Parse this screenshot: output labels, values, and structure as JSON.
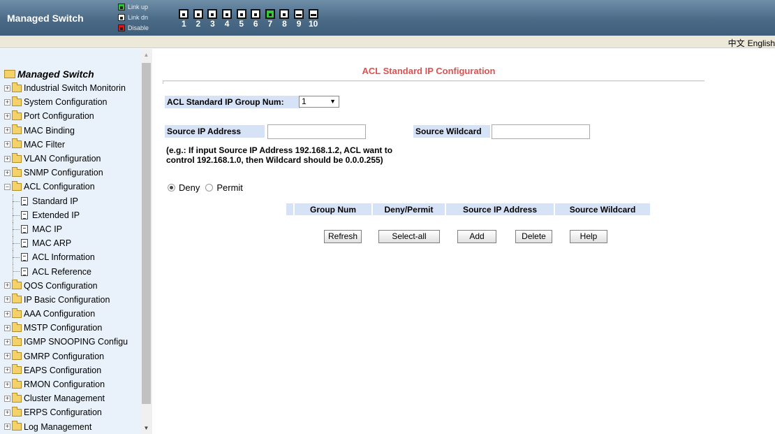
{
  "header": {
    "brand": "Managed Switch",
    "legend": [
      {
        "label": "Link up",
        "state": "up"
      },
      {
        "label": "Link dn",
        "state": "dn"
      },
      {
        "label": "Disable",
        "state": "dis"
      }
    ],
    "ports": [
      {
        "num": "1",
        "state": "dn"
      },
      {
        "num": "2",
        "state": "dn"
      },
      {
        "num": "3",
        "state": "dn"
      },
      {
        "num": "4",
        "state": "dn"
      },
      {
        "num": "5",
        "state": "dn"
      },
      {
        "num": "6",
        "state": "dn"
      },
      {
        "num": "7",
        "state": "up"
      },
      {
        "num": "8",
        "state": "dn"
      },
      {
        "num": "9",
        "state": "sfp"
      },
      {
        "num": "10",
        "state": "sfp"
      }
    ],
    "colors": {
      "link_up": "#36c03a",
      "link_dn": "#ffffff",
      "disable": "#d8181b"
    }
  },
  "language": {
    "chinese": "中文",
    "english": "English"
  },
  "sidebar": {
    "root": "Managed Switch",
    "items": [
      {
        "label": "Industrial Switch Monitorin",
        "type": "folder",
        "expanded": false
      },
      {
        "label": "System Configuration",
        "type": "folder",
        "expanded": false
      },
      {
        "label": "Port Configuration",
        "type": "folder",
        "expanded": false
      },
      {
        "label": "MAC Binding",
        "type": "folder",
        "expanded": false
      },
      {
        "label": "MAC Filter",
        "type": "folder",
        "expanded": false
      },
      {
        "label": "VLAN Configuration",
        "type": "folder",
        "expanded": false
      },
      {
        "label": "SNMP Configuration",
        "type": "folder",
        "expanded": false
      },
      {
        "label": "ACL Configuration",
        "type": "folder",
        "expanded": true
      },
      {
        "label": "Standard IP",
        "type": "page"
      },
      {
        "label": "Extended IP",
        "type": "page"
      },
      {
        "label": "MAC IP",
        "type": "page"
      },
      {
        "label": "MAC ARP",
        "type": "page"
      },
      {
        "label": "ACL Information",
        "type": "page"
      },
      {
        "label": "ACL Reference",
        "type": "page"
      },
      {
        "label": "QOS Configuration",
        "type": "folder",
        "expanded": false
      },
      {
        "label": "IP Basic Configuration",
        "type": "folder",
        "expanded": false
      },
      {
        "label": "AAA Configuration",
        "type": "folder",
        "expanded": false
      },
      {
        "label": "MSTP Configuration",
        "type": "folder",
        "expanded": false
      },
      {
        "label": "IGMP SNOOPING Configu",
        "type": "folder",
        "expanded": false
      },
      {
        "label": "GMRP Configuration",
        "type": "folder",
        "expanded": false
      },
      {
        "label": "EAPS Configuration",
        "type": "folder",
        "expanded": false
      },
      {
        "label": "RMON Configuration",
        "type": "folder",
        "expanded": false
      },
      {
        "label": "Cluster Management",
        "type": "folder",
        "expanded": false
      },
      {
        "label": "ERPS Configuration",
        "type": "folder",
        "expanded": false
      },
      {
        "label": "Log Management",
        "type": "folder",
        "expanded": false
      }
    ]
  },
  "main": {
    "title": "ACL Standard IP Configuration",
    "group_num_label": "ACL Standard IP Group Num:",
    "group_num_value": "1",
    "source_ip_label": "Source IP Address",
    "source_ip_value": "",
    "source_wildcard_label": "Source Wildcard",
    "source_wildcard_value": "",
    "note_line1": "(e.g.: If input Source IP Address 192.168.1.2, ACL want to",
    "note_line2": "control 192.168.1.0, then Wildcard should be 0.0.0.255)",
    "radio_options": [
      {
        "label": "Deny",
        "checked": true
      },
      {
        "label": "Permit",
        "checked": false
      }
    ],
    "table_headers": [
      "",
      "Group Num",
      "Deny/Permit",
      "Source IP Address",
      "Source Wildcard"
    ],
    "buttons": {
      "refresh": "Refresh",
      "select_all": "Select-all",
      "add": "Add",
      "delete": "Delete",
      "help": "Help"
    }
  }
}
